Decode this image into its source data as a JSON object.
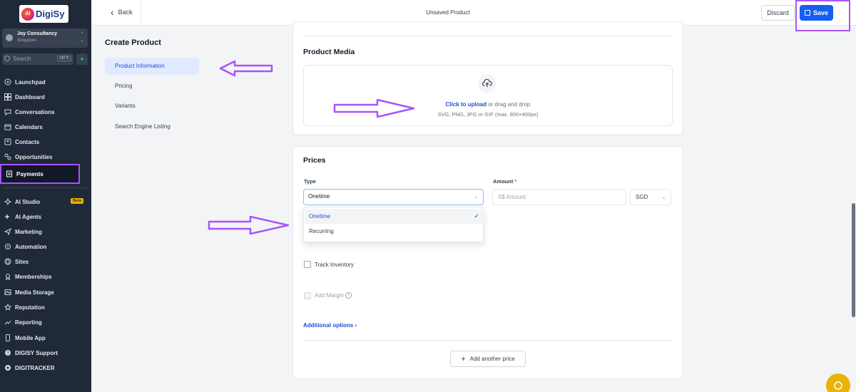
{
  "app": {
    "logo_text": "DigiSy",
    "account_name": "Joy Consultancy",
    "account_location": "Singapore",
    "search_placeholder": "Search",
    "search_shortcut": "ctrl K"
  },
  "sidebar": {
    "items": [
      {
        "label": "Launchpad",
        "icon": "rocket-icon"
      },
      {
        "label": "Dashboard",
        "icon": "grid-icon"
      },
      {
        "label": "Conversations",
        "icon": "chat-icon"
      },
      {
        "label": "Calendars",
        "icon": "calendar-icon"
      },
      {
        "label": "Contacts",
        "icon": "contacts-icon"
      },
      {
        "label": "Opportunities",
        "icon": "opportunities-icon"
      },
      {
        "label": "Payments",
        "icon": "payments-icon",
        "active": true
      },
      {
        "label": "AI Studio",
        "icon": "ai-studio-icon",
        "badge": "Beta"
      },
      {
        "label": "AI Agents",
        "icon": "sparkle-icon"
      },
      {
        "label": "Marketing",
        "icon": "send-icon"
      },
      {
        "label": "Automation",
        "icon": "automation-icon"
      },
      {
        "label": "Sites",
        "icon": "globe-icon"
      },
      {
        "label": "Memberships",
        "icon": "memberships-icon"
      },
      {
        "label": "Media Storage",
        "icon": "image-icon"
      },
      {
        "label": "Reputation",
        "icon": "star-icon"
      },
      {
        "label": "Reporting",
        "icon": "trend-icon"
      },
      {
        "label": "Mobile App",
        "icon": "mobile-icon"
      },
      {
        "label": "DIGISY Support",
        "icon": "support-icon"
      },
      {
        "label": "DIGITRACKER",
        "icon": "tracker-icon"
      }
    ]
  },
  "topbar": {
    "back_label": "Back",
    "title": "Unsaved Product",
    "discard_label": "Discard",
    "save_label": "Save"
  },
  "left_menu": {
    "title": "Create Product",
    "items": [
      "Product Information",
      "Pricing",
      "Variants",
      "Search Engine Listing"
    ]
  },
  "media": {
    "title": "Product Media",
    "upload_link": "Click to upload",
    "upload_rest": " or drag and drop",
    "upload_hint": "SVG, PNG, JPG or GIF (max. 800×400px)"
  },
  "prices": {
    "title": "Prices",
    "type_label": "Type",
    "type_value": "Onetime",
    "amount_label": "Amount",
    "amount_required": "*",
    "amount_placeholder": "S$ Amount",
    "currency": "SGD",
    "options": [
      "Onetime",
      "Recurring"
    ],
    "track_inventory": "Track Inventory",
    "add_margin": "Add Margin",
    "additional_options": "Additional options",
    "add_price": "Add another price"
  },
  "colors": {
    "accent": "#155eef",
    "annotation": "#a855f7",
    "sidebar_bg": "#1f2937"
  }
}
